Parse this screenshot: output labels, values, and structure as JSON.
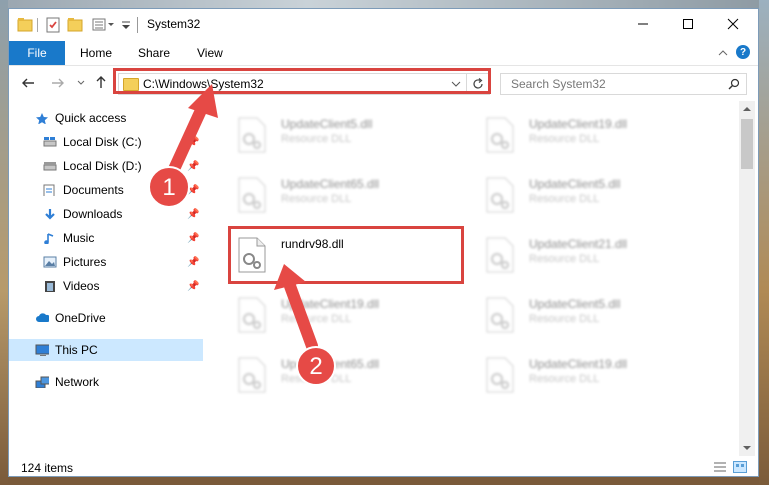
{
  "window": {
    "title": "System32"
  },
  "ribbon": {
    "tabs": [
      "File",
      "Home",
      "Share",
      "View"
    ]
  },
  "navigation": {
    "address": "C:\\Windows\\System32",
    "search_placeholder": "Search System32"
  },
  "sidebar": {
    "items": [
      {
        "label": "Quick access",
        "icon": "star-icon"
      },
      {
        "label": "Local Disk (C:)",
        "icon": "drive-icon"
      },
      {
        "label": "Local Disk (D:)",
        "icon": "drive-icon"
      },
      {
        "label": "Documents",
        "icon": "documents-icon"
      },
      {
        "label": "Downloads",
        "icon": "download-icon"
      },
      {
        "label": "Music",
        "icon": "music-icon"
      },
      {
        "label": "Pictures",
        "icon": "pictures-icon"
      },
      {
        "label": "Videos",
        "icon": "video-icon"
      },
      {
        "label": "OneDrive",
        "icon": "cloud-icon"
      },
      {
        "label": "This PC",
        "icon": "computer-icon"
      },
      {
        "label": "Network",
        "icon": "network-icon"
      }
    ]
  },
  "files": [
    {
      "name": "UpdateClient5.dll",
      "type": "Resource DLL"
    },
    {
      "name": "UpdateClient19.dll",
      "type": "Resource DLL"
    },
    {
      "name": "UpdateClient65.dll",
      "type": "Resource DLL"
    },
    {
      "name": "UpdateClient5.dll",
      "type": "Resource DLL"
    },
    {
      "name": "rundrv98.dll",
      "type": ""
    },
    {
      "name": "UpdateClient21.dll",
      "type": "Resource DLL"
    },
    {
      "name": "UpdateClient19.dll",
      "type": "Resource DLL"
    },
    {
      "name": "UpdateClient5.dll",
      "type": "Resource DLL"
    },
    {
      "name": "UpdateClient65.dll",
      "type": "Resource DLL"
    },
    {
      "name": "UpdateClient19.dll",
      "type": "Resource DLL"
    }
  ],
  "status": {
    "count": "124 items"
  },
  "annotations": {
    "step1": "1",
    "step2": "2"
  },
  "colors": {
    "accent": "#1979ca",
    "highlight": "#d9443f",
    "selected": "#cce8ff"
  }
}
